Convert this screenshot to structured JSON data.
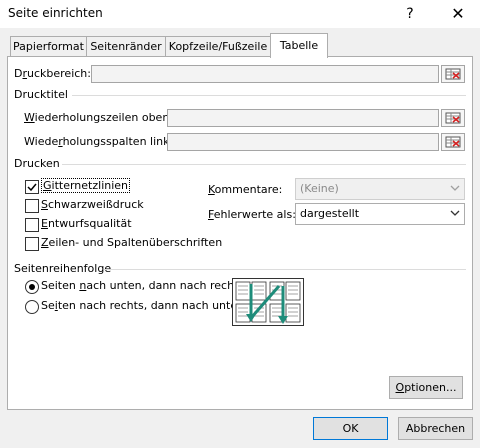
{
  "window": {
    "title": "Seite einrichten",
    "help": "?",
    "close": "✕"
  },
  "tabs": [
    {
      "label": "Papierformat"
    },
    {
      "label": "Seitenränder"
    },
    {
      "label": "Kopfzeile/Fußzeile"
    },
    {
      "label": "Tabelle",
      "active": true
    }
  ],
  "print_area": {
    "label_pre": "D",
    "label_u": "r",
    "label_post": "uckbereich:",
    "value": ""
  },
  "print_titles": {
    "group_label": "Drucktitel",
    "rows_label_u": "W",
    "rows_label_post": "iederholungszeilen oben:",
    "cols_label_pre": "Wiede",
    "cols_label_u": "r",
    "cols_label_post": "holungsspalten links:",
    "rows_value": "",
    "cols_value": ""
  },
  "print": {
    "group_label": "Drucken",
    "options": [
      {
        "pre": "",
        "u": "G",
        "post": "itternetzlinien",
        "checked": true
      },
      {
        "pre": "",
        "u": "S",
        "post": "chwarzweißdruck",
        "checked": false
      },
      {
        "pre": "",
        "u": "E",
        "post": "ntwurfsqualität",
        "checked": false
      },
      {
        "pre": "",
        "u": "Z",
        "post": "eilen- und Spaltenüberschriften",
        "checked": false
      }
    ],
    "comments_label_u": "K",
    "comments_label_post": "ommentare:",
    "comments_value": "(Keine)",
    "errors_label_u": "F",
    "errors_label_post": "ehlerwerte als:",
    "errors_value": "dargestellt"
  },
  "page_order": {
    "group_label": "Seitenreihenfolge",
    "options": [
      {
        "pre": "Seiten ",
        "u": "n",
        "post": "ach unten, dann nach rechts",
        "selected": true
      },
      {
        "pre": "Se",
        "u": "i",
        "post": "ten nach rechts, dann nach unten",
        "selected": false
      }
    ]
  },
  "buttons": {
    "options_u": "O",
    "options_post": "ptionen...",
    "ok": "OK",
    "cancel": "Abbrechen"
  },
  "colors": {
    "accent": "#0078d7",
    "arrow": "#1e8c7a",
    "ref_red": "#d42020"
  },
  "icons": {
    "ref": "collapse-dialog-icon",
    "select_arrow": "chevron-down-icon"
  }
}
